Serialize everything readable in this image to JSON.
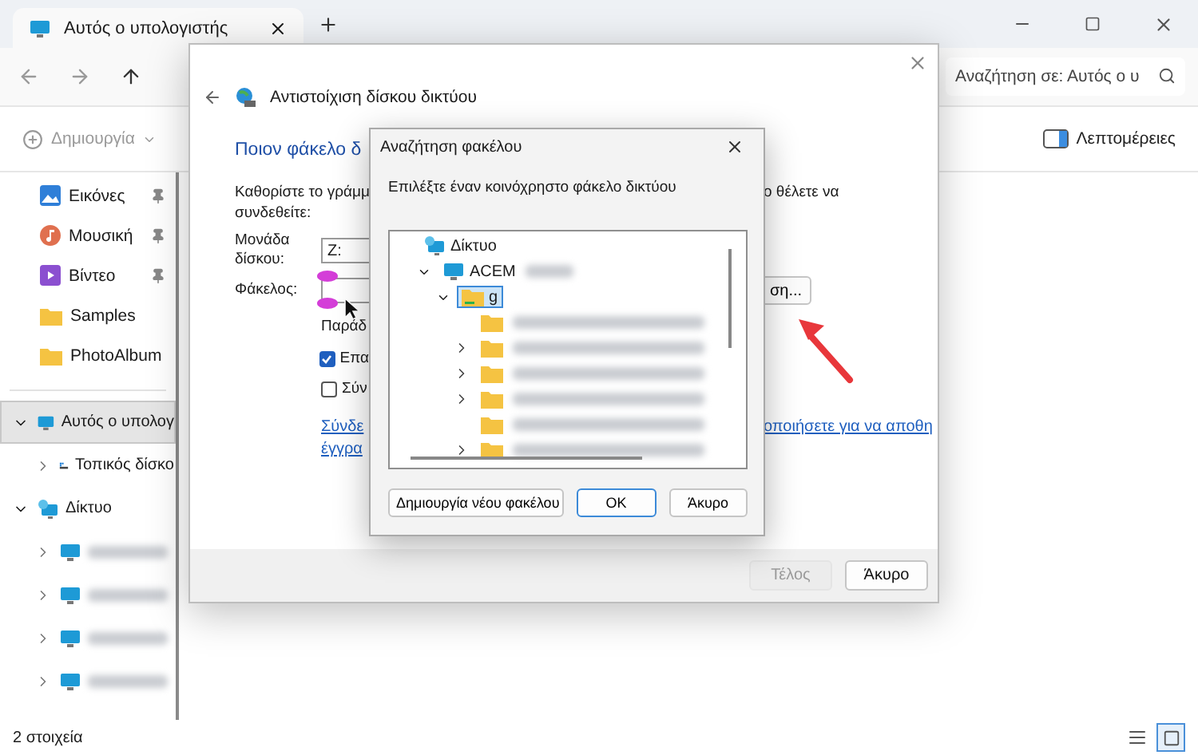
{
  "explorer": {
    "tab": {
      "title": "Αυτός ο υπολογιστής"
    },
    "search": {
      "placeholder": "Αναζήτηση σε: Αυτός ο υ"
    },
    "toolbar": {
      "new_item": {
        "label": "Δημιουργία",
        "disabled": true
      },
      "details": {
        "label": "Λεπτομέρειες"
      }
    },
    "sidebar": {
      "quick_access": [
        {
          "label": "Εικόνες",
          "kind": "pictures",
          "pinned": true
        },
        {
          "label": "Μουσική",
          "kind": "music",
          "pinned": true
        },
        {
          "label": "Βίντεο",
          "kind": "video",
          "pinned": true
        },
        {
          "label": "Samples",
          "kind": "folder",
          "pinned": false
        },
        {
          "label": "PhotoAlbum",
          "kind": "folder",
          "pinned": false
        }
      ],
      "tree": [
        {
          "label": "Αυτός ο υπολογ",
          "kind": "computer",
          "selected": true,
          "expanded": true,
          "children": [
            {
              "label": "Τοπικός δίσκο",
              "kind": "drive",
              "selected": false,
              "expanded": false
            }
          ]
        },
        {
          "label": "Δίκτυο",
          "kind": "network",
          "selected": false,
          "expanded": true,
          "children": [
            {
              "kind": "computer",
              "selected": false,
              "expanded": false,
              "redacted": true
            },
            {
              "kind": "computer",
              "selected": false,
              "expanded": false,
              "redacted": true
            },
            {
              "kind": "computer",
              "selected": false,
              "expanded": false,
              "redacted": true
            },
            {
              "kind": "computer",
              "selected": false,
              "expanded": false,
              "redacted": true
            }
          ]
        }
      ]
    },
    "status_bar": "2 στοιχεία",
    "views": [
      {
        "kind": "details",
        "selected": false
      },
      {
        "kind": "tiles",
        "selected": true
      }
    ]
  },
  "map_dialog": {
    "title": "Αντιστοίχιση δίσκου δικτύου",
    "heading": "Ποιον φάκελο δ",
    "instruction": {
      "left": "Καθορίστε το γράμμ",
      "right": "ο θέλετε να",
      "line2": "συνδεθείτε:"
    },
    "drive": {
      "label": "Μονάδα δίσκου:",
      "value": "Z:"
    },
    "folder": {
      "label": "Φάκελος:",
      "browse_button": "ση..."
    },
    "example": "Παράδ",
    "checkboxes": [
      {
        "label": "Επα",
        "checked": true
      },
      {
        "label": "Σύν",
        "checked": false
      }
    ],
    "link": {
      "left": "Σύνδε",
      "right": "οποιήσετε για να αποθη",
      "line2": "έγγρα"
    },
    "buttons": [
      {
        "label": "Τέλος",
        "disabled": true
      },
      {
        "label": "Άκυρο",
        "disabled": false
      }
    ]
  },
  "browse_dialog": {
    "title": "Αναζήτηση φακέλου",
    "prompt": "Επιλέξτε έναν κοινόχρηστο φάκελο δικτύου",
    "tree": [
      {
        "label": "Δίκτυο",
        "kind": "network",
        "selected": false,
        "children": [
          {
            "label": "ACEM",
            "kind": "computer",
            "expanded": true,
            "selected": false,
            "redacted": true,
            "children": [
              {
                "label": "g",
                "kind": "share",
                "expanded": true,
                "selected": true,
                "children": [
                  {
                    "kind": "folder",
                    "expandable": false,
                    "selected": false,
                    "redacted": true
                  },
                  {
                    "kind": "folder",
                    "expandable": true,
                    "selected": false,
                    "redacted": true
                  },
                  {
                    "kind": "folder",
                    "expandable": true,
                    "selected": false,
                    "redacted": true
                  },
                  {
                    "kind": "folder",
                    "expandable": true,
                    "selected": false,
                    "redacted": true
                  },
                  {
                    "kind": "folder",
                    "expandable": false,
                    "selected": false,
                    "redacted": true
                  },
                  {
                    "kind": "folder",
                    "expandable": true,
                    "selected": false,
                    "redacted": true
                  }
                ]
              }
            ]
          }
        ]
      }
    ],
    "buttons": [
      {
        "label": "Δημιουργία νέου φακέλου",
        "default": false
      },
      {
        "label": "OK",
        "default": true
      },
      {
        "label": "Άκυρο",
        "default": false
      }
    ]
  }
}
